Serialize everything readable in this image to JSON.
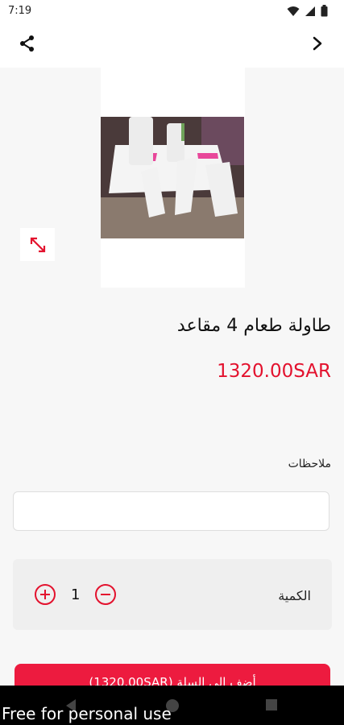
{
  "status_bar": {
    "time": "7:19"
  },
  "app_bar": {
    "share_icon": "share-icon",
    "forward_icon": "chevron-right-icon"
  },
  "product": {
    "name": "طاولة طعام 4 مقاعد",
    "price": "1320.00SAR"
  },
  "notes": {
    "label": "ملاحظات",
    "value": ""
  },
  "quantity": {
    "label": "الكمية",
    "value": "1"
  },
  "add_to_cart": {
    "label": "أضف إلى السلة (1320.00SAR)"
  },
  "watermark": {
    "text": "Free for personal use"
  },
  "colors": {
    "accent": "#e3122e",
    "button": "#ed1b3f"
  }
}
